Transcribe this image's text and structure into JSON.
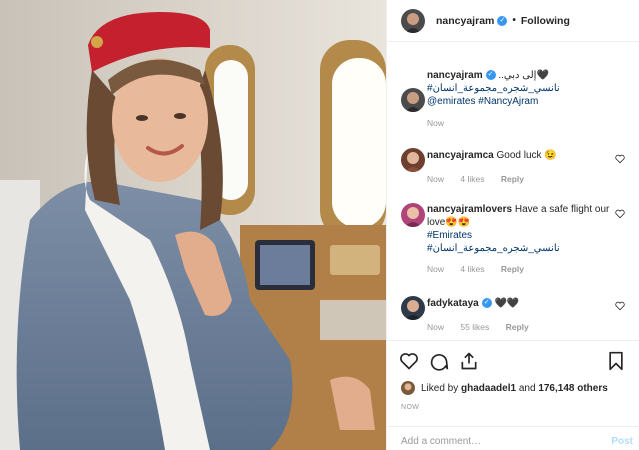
{
  "header": {
    "username": "nancyajram",
    "follow_label": "Following"
  },
  "caption": {
    "username": "nancyajram",
    "text": "إلى دبي..",
    "emoji": "🖤",
    "hashtag_arabic": "#نانسي_شجره_مجموعة_انسان",
    "mention": "@emirates",
    "hashtag": "#NancyAjram",
    "time": "Now"
  },
  "comments": [
    {
      "username": "nancyajramca",
      "text": "Good luck 😉",
      "time": "Now",
      "likes": "4 likes",
      "reply": "Reply"
    },
    {
      "username": "nancyajramlovers",
      "text": "Have a safe flight our love😍😍",
      "hashtag": "#Emirates",
      "hashtag_arabic": "#نانسي_شجره_مجموعة_انسان",
      "time": "Now",
      "likes": "4 likes",
      "reply": "Reply"
    },
    {
      "username": "fadykataya",
      "text": "🖤🖤",
      "time": "Now",
      "likes": "55 likes",
      "reply": "Reply"
    }
  ],
  "likes": {
    "prefix": "Liked by ",
    "user": "ghadaadel1",
    "middle": " and ",
    "count": "176,148 others"
  },
  "timestamp": "NOW",
  "add_comment": {
    "placeholder": "Add a comment…",
    "post_label": "Post"
  },
  "icons": [
    "heart-icon",
    "comment-icon",
    "share-icon",
    "bookmark-icon",
    "verified-icon"
  ],
  "colors": {
    "verified": "#3897f0",
    "link": "#003569",
    "muted": "#999999",
    "post_disabled": "#b2dffc"
  }
}
